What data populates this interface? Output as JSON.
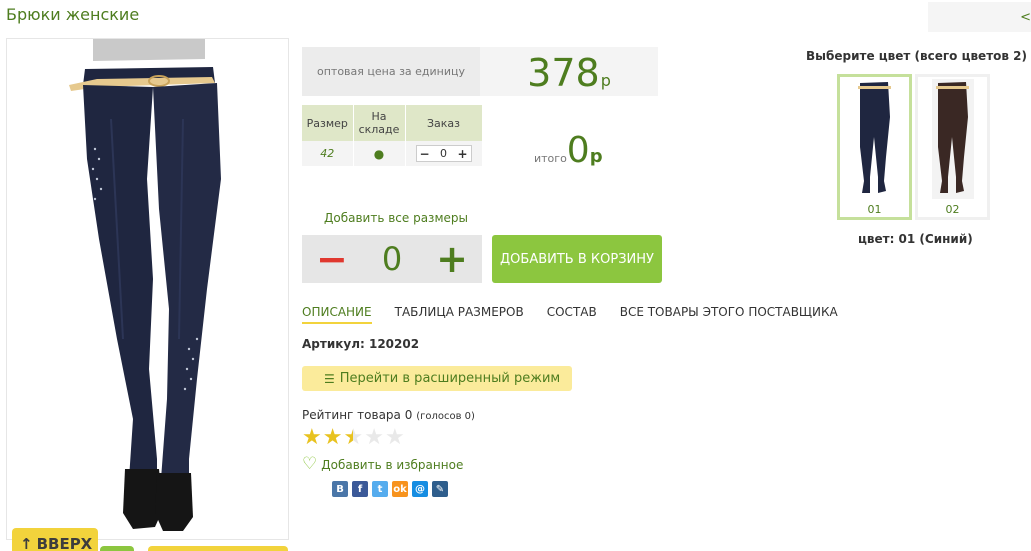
{
  "page": {
    "title": "Брюки женские",
    "nav_arrow": "<"
  },
  "price": {
    "label": "оптовая цена за единицу",
    "value": "378",
    "currency": "р"
  },
  "size_table": {
    "headers": [
      "Размер",
      "На складе",
      "Заказ"
    ],
    "rows": [
      {
        "size": "42",
        "stock": "●",
        "qty": "0",
        "minus": "−",
        "plus": "+"
      }
    ]
  },
  "total": {
    "label": "итого",
    "value": "0",
    "currency": "р"
  },
  "add_all_label": "Добавить все размеры",
  "big_stepper": {
    "minus": "−",
    "count": "0",
    "plus": "+"
  },
  "cart_button": "ДОБАВИТЬ В КОРЗИНУ",
  "tabs": [
    "ОПИСАНИЕ",
    "ТАБЛИЦА РАЗМЕРОВ",
    "СОСТАВ",
    "ВСЕ ТОВАРЫ ЭТОГО ПОСТАВЩИКА"
  ],
  "article": "Артикул: 120202",
  "advanced_button": "Перейти в расширенный режим",
  "rating": {
    "label": "Рейтинг товара 0",
    "votes": "(голосов 0)",
    "stars_value": 2.5,
    "stars_max": 5
  },
  "favorite": "Добавить в избранное",
  "social": [
    {
      "icon": "vkontakte-icon",
      "glyph": "B",
      "color": "#4a76a8"
    },
    {
      "icon": "facebook-icon",
      "glyph": "f",
      "color": "#3b5998"
    },
    {
      "icon": "twitter-icon",
      "glyph": "t",
      "color": "#55acee"
    },
    {
      "icon": "odnoklassniki-icon",
      "glyph": "ok",
      "color": "#f7931e"
    },
    {
      "icon": "mailru-icon",
      "glyph": "@",
      "color": "#168de2"
    },
    {
      "icon": "livejournal-icon",
      "glyph": "✎",
      "color": "#2f5e8c"
    }
  ],
  "colors": {
    "title": "Выберите цвет (всего цветов 2)",
    "swatches": [
      {
        "num": "01",
        "color": "#1f2640"
      },
      {
        "num": "02",
        "color": "#3a2824"
      }
    ],
    "selected_label": "цвет: 01 (Синий)"
  },
  "up_button": "ВВЕРХ",
  "accent": {
    "green": "#4e7d1f",
    "light_green": "#8cc63f",
    "yellow": "#f2d33c",
    "red": "#e0382f"
  }
}
